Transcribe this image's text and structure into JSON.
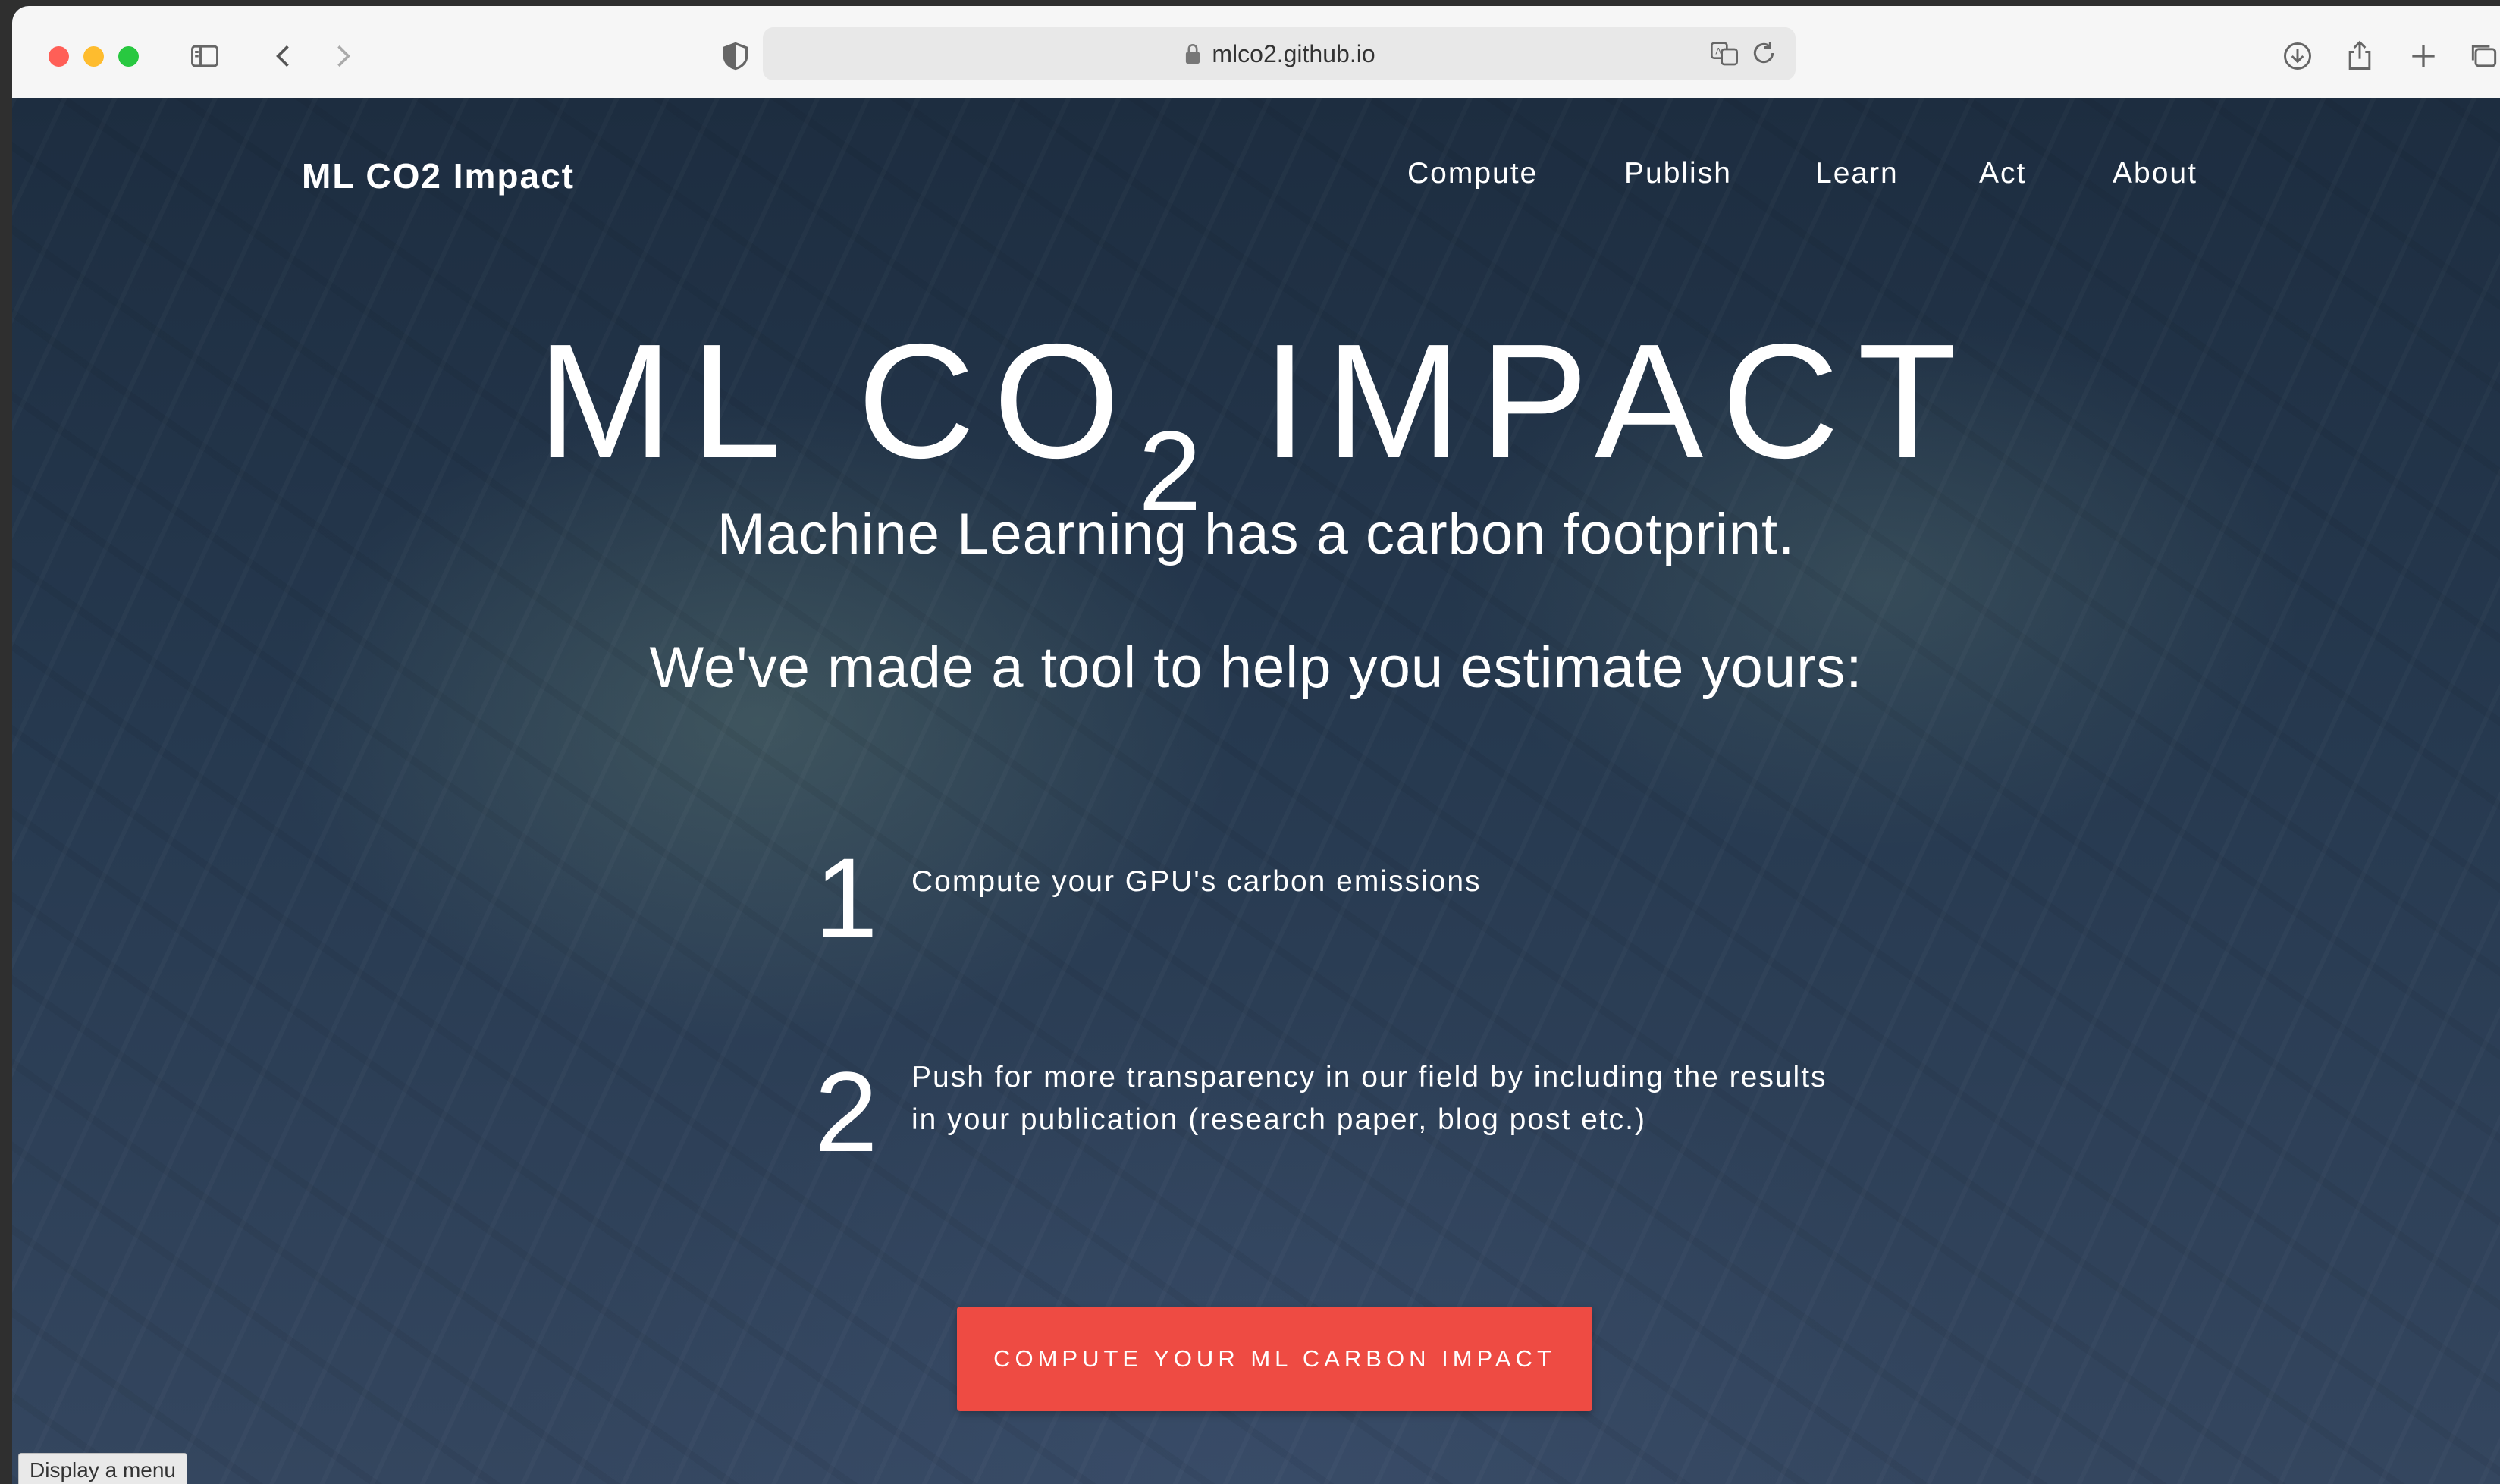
{
  "browser": {
    "url": "mlco2.github.io"
  },
  "site": {
    "brand": "ML CO2 Impact",
    "nav": [
      "Compute",
      "Publish",
      "Learn",
      "Act",
      "About"
    ]
  },
  "hero": {
    "title_left": "ML CO",
    "title_sub": "2",
    "title_right": "IMPACT",
    "tagline1": "Machine Learning has a carbon footprint.",
    "tagline2": "We've made a tool to help you estimate yours:"
  },
  "steps": [
    {
      "number": "1",
      "text": "Compute your GPU's carbon emissions"
    },
    {
      "number": "2",
      "text": "Push for more transparency in our field by including the results in your publication (research paper, blog post etc.)"
    }
  ],
  "cta": {
    "label": "COMPUTE YOUR ML CARBON IMPACT"
  },
  "status": {
    "tooltip": "Display a menu"
  },
  "colors": {
    "cta": "#ee4b43",
    "background": "#1d2d40"
  }
}
